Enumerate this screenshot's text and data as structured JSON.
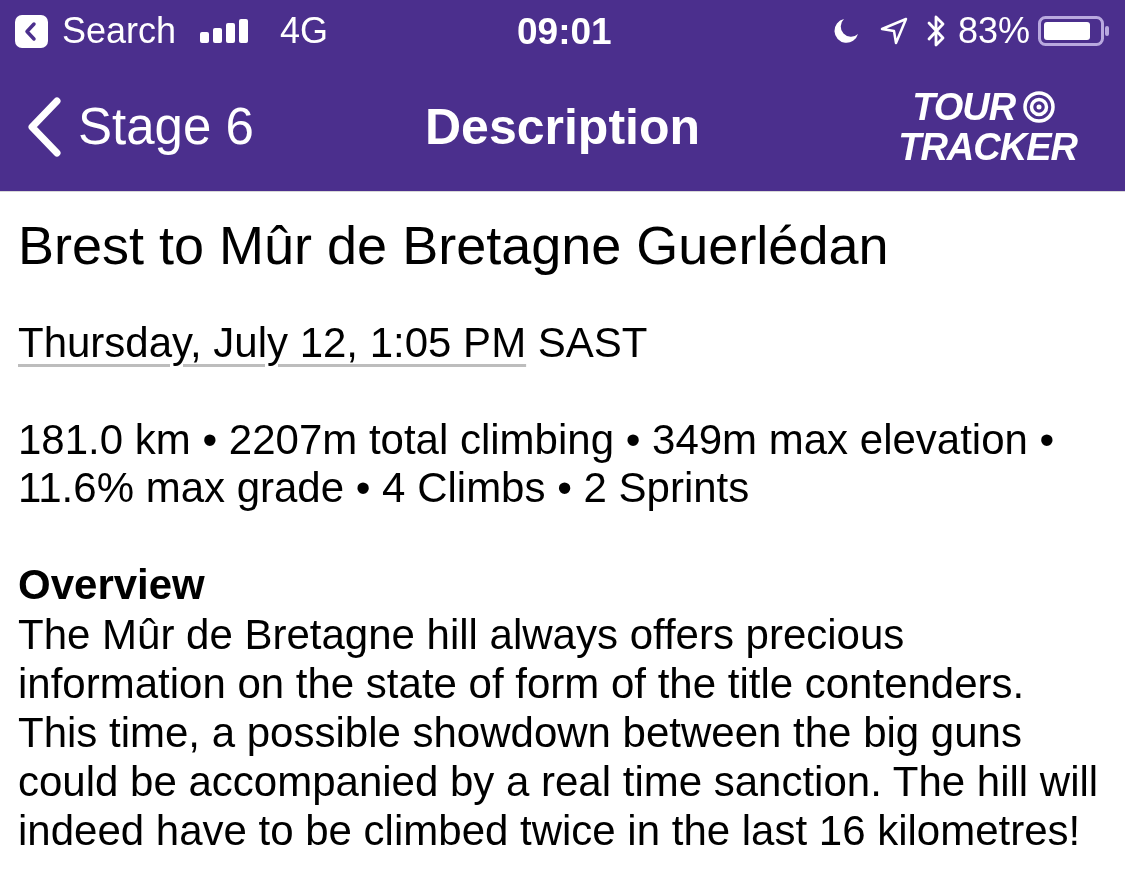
{
  "status_bar": {
    "back_label": "Search",
    "network": "4G",
    "time": "09:01",
    "battery": "83%"
  },
  "nav_bar": {
    "back_label": "Stage 6",
    "title": "Description",
    "logo": [
      "TOUR",
      "TRACKER"
    ]
  },
  "stage": {
    "title": "Brest to Mûr de Bretagne Guerlédan",
    "date_link": "Thursday, July 12, 1:05 PM",
    "timezone": "SAST",
    "stats": "181.0 km • 2207m total climbing • 349m max elevation • 11.6% max grade • 4 Climbs • 2 Sprints"
  },
  "overview": {
    "heading": "Overview",
    "text": "The Mûr de Bretagne hill always offers precious information on the state of form of the title contenders. This time, a possible showdown between the big guns could be accompanied by a real time sanction. The hill will indeed have to be climbed twice in the last 16 kilometres!"
  }
}
